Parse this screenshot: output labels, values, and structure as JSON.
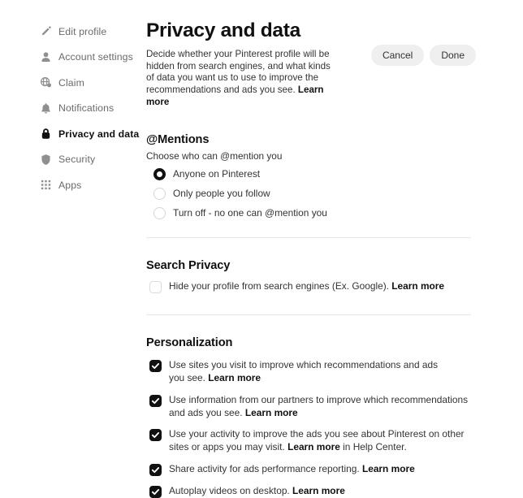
{
  "sidebar": {
    "items": [
      {
        "label": "Edit profile",
        "icon": "pencil-icon",
        "active": false
      },
      {
        "label": "Account settings",
        "icon": "person-icon",
        "active": false
      },
      {
        "label": "Claim",
        "icon": "globe-badge-icon",
        "active": false
      },
      {
        "label": "Notifications",
        "icon": "bell-icon",
        "active": false
      },
      {
        "label": "Privacy and data",
        "icon": "lock-icon",
        "active": true
      },
      {
        "label": "Security",
        "icon": "shield-icon",
        "active": false
      },
      {
        "label": "Apps",
        "icon": "grid-dots-icon",
        "active": false
      }
    ]
  },
  "header": {
    "title": "Privacy and data",
    "description": "Decide whether your Pinterest profile will be hidden from search engines, and what kinds of data you want us to use to improve the recommendations and ads you see.",
    "description_link": "Learn more",
    "cancel_label": "Cancel",
    "done_label": "Done"
  },
  "mentions": {
    "heading": "@Mentions",
    "helper": "Choose who can @mention you",
    "options": [
      {
        "label": "Anyone on Pinterest",
        "selected": true
      },
      {
        "label": "Only people you follow",
        "selected": false
      },
      {
        "label": "Turn off - no one can @mention you",
        "selected": false
      }
    ]
  },
  "search_privacy": {
    "heading": "Search Privacy",
    "option": {
      "text": "Hide your profile from search engines (Ex. Google).",
      "link": "Learn more",
      "checked": false
    }
  },
  "personalization": {
    "heading": "Personalization",
    "options": [
      {
        "text_before": "Use sites you visit to improve which recommendations and ads you see.",
        "link": "Learn more",
        "text_after": "",
        "checked": true
      },
      {
        "text_before": "Use information from our partners to improve which recommendations and ads you see.",
        "link": "Learn more",
        "text_after": "",
        "checked": true
      },
      {
        "text_before": "Use your activity to improve the ads you see about Pinterest on other sites or apps you may visit.",
        "link": "Learn more",
        "text_after": "in Help Center.",
        "checked": true
      },
      {
        "text_before": "Share activity for ads performance reporting.",
        "link": "Learn more",
        "text_after": "",
        "checked": true
      },
      {
        "text_before": "Autoplay videos on desktop.",
        "link": "Learn more",
        "text_after": "",
        "checked": true
      }
    ]
  },
  "colors": {
    "accent": "#111111",
    "muted_text": "#6b6b6b",
    "body_text": "#333333",
    "pill_bg": "#efefef",
    "divider": "#e6e6e6"
  }
}
